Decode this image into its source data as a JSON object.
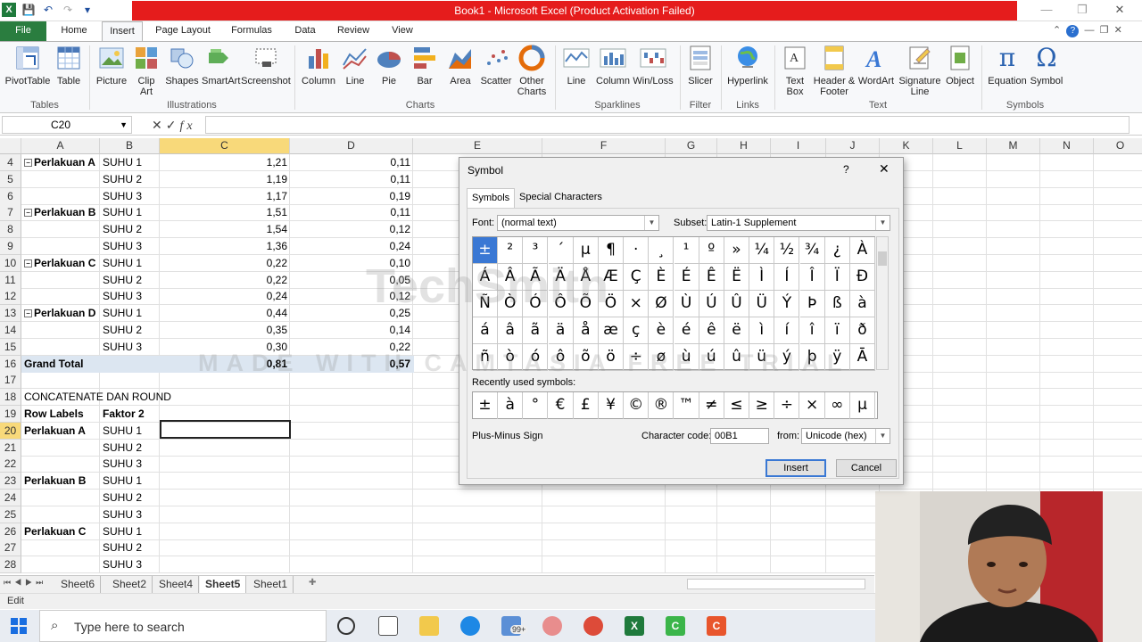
{
  "titlebar": {
    "title": "Book1 - Microsoft Excel (Product Activation Failed)"
  },
  "ribbon_tabs": [
    "File",
    "Home",
    "Insert",
    "Page Layout",
    "Formulas",
    "Data",
    "Review",
    "View"
  ],
  "ribbon": {
    "groups": {
      "tables": "Tables",
      "illustrations": "Illustrations",
      "charts": "Charts",
      "sparklines": "Sparklines",
      "filter": "Filter",
      "links": "Links",
      "text": "Text",
      "symbols": "Symbols"
    },
    "buttons": {
      "pivottable": "PivotTable",
      "table": "Table",
      "picture": "Picture",
      "clipart": "Clip Art",
      "shapes": "Shapes",
      "smartart": "SmartArt",
      "screenshot": "Screenshot",
      "column": "Column",
      "line": "Line",
      "pie": "Pie",
      "bar": "Bar",
      "area": "Area",
      "scatter": "Scatter",
      "othercharts": "Other Charts",
      "spark_line": "Line",
      "spark_column": "Column",
      "spark_winloss": "Win/Loss",
      "slicer": "Slicer",
      "hyperlink": "Hyperlink",
      "textbox": "Text Box",
      "headerfooter": "Header & Footer",
      "wordart": "WordArt",
      "signature": "Signature Line",
      "object": "Object",
      "equation": "Equation",
      "symbol": "Symbol"
    }
  },
  "formula_bar": {
    "name_box": "C20",
    "formula": ""
  },
  "columns": [
    "A",
    "B",
    "C",
    "D",
    "E",
    "F",
    "G",
    "H",
    "I",
    "J",
    "K",
    "L",
    "M",
    "N",
    "O"
  ],
  "rows": [
    {
      "n": "4",
      "a": "Perlakuan A",
      "b": "SUHU 1",
      "c": "1,21",
      "d": "0,11",
      "exp": true
    },
    {
      "n": "5",
      "a": "",
      "b": "SUHU 2",
      "c": "1,19",
      "d": "0,11"
    },
    {
      "n": "6",
      "a": "",
      "b": "SUHU 3",
      "c": "1,17",
      "d": "0,19"
    },
    {
      "n": "7",
      "a": "Perlakuan B",
      "b": "SUHU 1",
      "c": "1,51",
      "d": "0,11",
      "exp": true
    },
    {
      "n": "8",
      "a": "",
      "b": "SUHU 2",
      "c": "1,54",
      "d": "0,12"
    },
    {
      "n": "9",
      "a": "",
      "b": "SUHU 3",
      "c": "1,36",
      "d": "0,24"
    },
    {
      "n": "10",
      "a": "Perlakuan C",
      "b": "SUHU 1",
      "c": "0,22",
      "d": "0,10",
      "exp": true
    },
    {
      "n": "11",
      "a": "",
      "b": "SUHU 2",
      "c": "0,22",
      "d": "0,05"
    },
    {
      "n": "12",
      "a": "",
      "b": "SUHU 3",
      "c": "0,24",
      "d": "0,12"
    },
    {
      "n": "13",
      "a": "Perlakuan D",
      "b": "SUHU 1",
      "c": "0,44",
      "d": "0,25",
      "exp": true
    },
    {
      "n": "14",
      "a": "",
      "b": "SUHU 2",
      "c": "0,35",
      "d": "0,14"
    },
    {
      "n": "15",
      "a": "",
      "b": "SUHU 3",
      "c": "0,30",
      "d": "0,22"
    },
    {
      "n": "16",
      "a": "Grand Total",
      "b": "",
      "c": "0,81",
      "d": "0,57",
      "total": true
    },
    {
      "n": "17",
      "a": "",
      "b": "",
      "c": "",
      "d": ""
    },
    {
      "n": "18",
      "a": "CONCATENATE DAN ROUND",
      "b": "",
      "c": "",
      "d": ""
    },
    {
      "n": "19",
      "a": "Row Labels",
      "b": "Faktor 2",
      "c": "",
      "d": "",
      "hdr": true
    },
    {
      "n": "20",
      "a": "Perlakuan A",
      "b": "SUHU 1",
      "c": "",
      "d": "",
      "boldA": true
    },
    {
      "n": "21",
      "a": "",
      "b": "SUHU 2",
      "c": "",
      "d": ""
    },
    {
      "n": "22",
      "a": "",
      "b": "SUHU 3",
      "c": "",
      "d": ""
    },
    {
      "n": "23",
      "a": "Perlakuan B",
      "b": "SUHU 1",
      "c": "",
      "d": "",
      "boldA": true
    },
    {
      "n": "24",
      "a": "",
      "b": "SUHU 2",
      "c": "",
      "d": ""
    },
    {
      "n": "25",
      "a": "",
      "b": "SUHU 3",
      "c": "",
      "d": ""
    },
    {
      "n": "26",
      "a": "Perlakuan C",
      "b": "SUHU 1",
      "c": "",
      "d": "",
      "boldA": true
    },
    {
      "n": "27",
      "a": "",
      "b": "SUHU 2",
      "c": "",
      "d": ""
    },
    {
      "n": "28",
      "a": "",
      "b": "SUHU 3",
      "c": "",
      "d": ""
    }
  ],
  "sheet_tabs": [
    "Sheet6",
    "Sheet2",
    "Sheet4",
    "Sheet5",
    "Sheet1"
  ],
  "active_sheet": "Sheet5",
  "status": "Edit",
  "dialog": {
    "title": "Symbol",
    "help": "?",
    "close": "✕",
    "tabs": [
      "Symbols",
      "Special Characters"
    ],
    "font_label": "Font:",
    "font_value": "(normal text)",
    "subset_label": "Subset:",
    "subset_value": "Latin-1 Supplement",
    "symbols": [
      [
        "±",
        "²",
        "³",
        "´",
        "µ",
        "¶",
        "·",
        "¸",
        "¹",
        "º",
        "»",
        "¼",
        "½",
        "¾",
        "¿",
        "À"
      ],
      [
        "Á",
        "Â",
        "Ã",
        "Ä",
        "Å",
        "Æ",
        "Ç",
        "È",
        "É",
        "Ê",
        "Ë",
        "Ì",
        "Í",
        "Î",
        "Ï",
        "Ð"
      ],
      [
        "Ñ",
        "Ò",
        "Ó",
        "Ô",
        "Õ",
        "Ö",
        "×",
        "Ø",
        "Ù",
        "Ú",
        "Û",
        "Ü",
        "Ý",
        "Þ",
        "ß",
        "à"
      ],
      [
        "á",
        "â",
        "ã",
        "ä",
        "å",
        "æ",
        "ç",
        "è",
        "é",
        "ê",
        "ë",
        "ì",
        "í",
        "î",
        "ï",
        "ð"
      ],
      [
        "ñ",
        "ò",
        "ó",
        "ô",
        "õ",
        "ö",
        "÷",
        "ø",
        "ù",
        "ú",
        "û",
        "ü",
        "ý",
        "þ",
        "ÿ",
        "Ā"
      ]
    ],
    "recent_label": "Recently used symbols:",
    "recent": [
      "±",
      "à",
      "°",
      "€",
      "£",
      "¥",
      "©",
      "®",
      "™",
      "≠",
      "≤",
      "≥",
      "÷",
      "×",
      "∞",
      "µ"
    ],
    "char_name": "Plus-Minus Sign",
    "char_code_label": "Character code:",
    "char_code": "00B1",
    "from_label": "from:",
    "from_value": "Unicode (hex)",
    "insert": "Insert",
    "cancel": "Cancel"
  },
  "taskbar": {
    "search_placeholder": "Type here to search",
    "badge": "99+"
  },
  "watermark": {
    "line1": "TechSmith",
    "line2": "MADE WITH CAMTASIA FREE TRIAL"
  }
}
